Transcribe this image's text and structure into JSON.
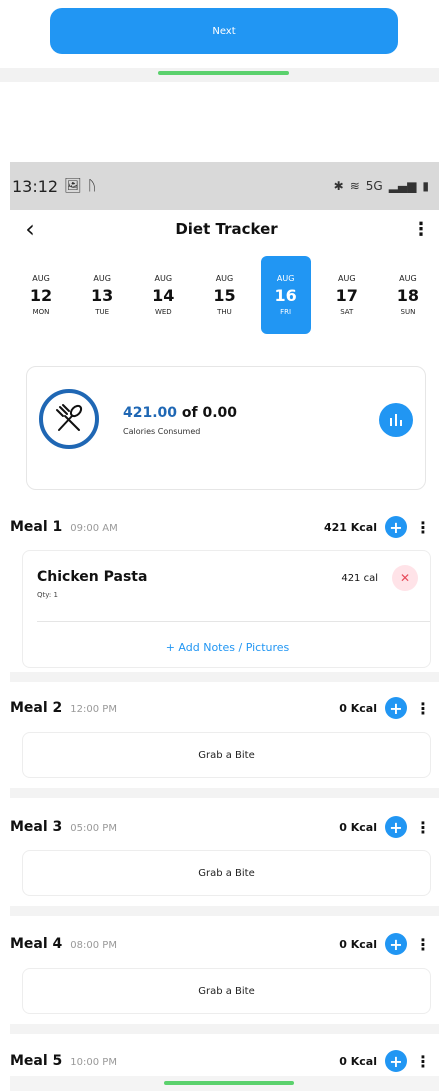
{
  "top": {
    "next_label": "Next"
  },
  "status_bar": {
    "time": "13:12",
    "left_icons": [
      "gallery-icon",
      "activity-icon"
    ],
    "right_icons": [
      "bluetooth-icon",
      "wifi-icon",
      "volte-5g-icon",
      "signal-icon",
      "battery-icon"
    ]
  },
  "header": {
    "title": "Diet Tracker"
  },
  "week": [
    {
      "month": "AUG",
      "day": "12",
      "weekday": "MON",
      "selected": false
    },
    {
      "month": "AUG",
      "day": "13",
      "weekday": "TUE",
      "selected": false
    },
    {
      "month": "AUG",
      "day": "14",
      "weekday": "WED",
      "selected": false
    },
    {
      "month": "AUG",
      "day": "15",
      "weekday": "THU",
      "selected": false
    },
    {
      "month": "AUG",
      "day": "16",
      "weekday": "FRI",
      "selected": true
    },
    {
      "month": "AUG",
      "day": "17",
      "weekday": "SAT",
      "selected": false
    },
    {
      "month": "AUG",
      "day": "18",
      "weekday": "SUN",
      "selected": false
    }
  ],
  "summary": {
    "consumed": "421.00",
    "of_text": " of ",
    "goal": "0.00",
    "label": "Calories Consumed"
  },
  "meals": [
    {
      "name": "Meal 1",
      "time": "09:00 AM",
      "kcal": "421 Kcal",
      "items": [
        {
          "name": "Chicken Pasta",
          "qty": "Qty: 1",
          "cal": "421 cal"
        }
      ],
      "add_notes": "+ Add Notes / Pictures"
    },
    {
      "name": "Meal 2",
      "time": "12:00 PM",
      "kcal": "0 Kcal",
      "empty_text": "Grab a Bite"
    },
    {
      "name": "Meal 3",
      "time": "05:00 PM",
      "kcal": "0 Kcal",
      "empty_text": "Grab a Bite"
    },
    {
      "name": "Meal 4",
      "time": "08:00 PM",
      "kcal": "0 Kcal",
      "empty_text": "Grab a Bite"
    },
    {
      "name": "Meal 5",
      "time": "10:00 PM",
      "kcal": "0 Kcal"
    }
  ],
  "colors": {
    "accent": "#2196f3",
    "accent_dark": "#1f67b4",
    "remove_bg": "#ffe3e8",
    "remove_fg": "#e74a5a",
    "home_indicator": "#5bd16d"
  }
}
